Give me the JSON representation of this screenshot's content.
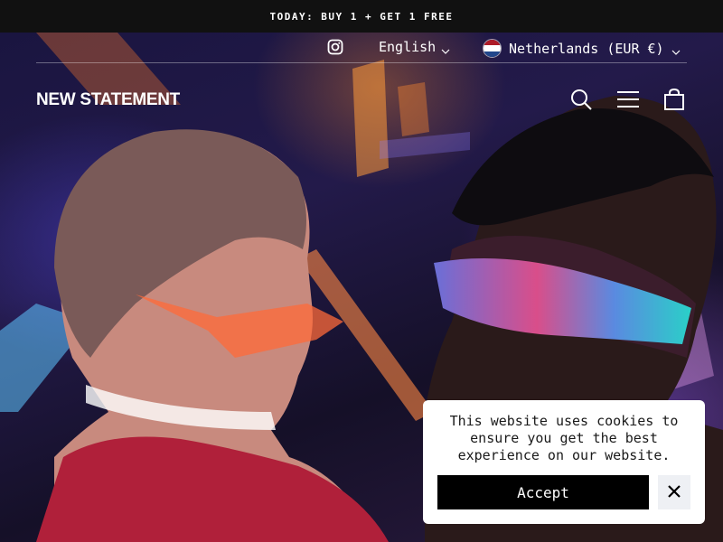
{
  "announcement": {
    "text": "TODAY: BUY 1 + GET 1 FREE"
  },
  "utility": {
    "instagram_icon": "instagram-icon",
    "language": "English",
    "country": "Netherlands (EUR €)",
    "flag_colors": [
      "#AE1C28",
      "#FFFFFF",
      "#21468B"
    ]
  },
  "header": {
    "logo": "NEW STATEMENT",
    "icons": [
      "search-icon",
      "menu-icon",
      "cart-icon"
    ]
  },
  "hero": {
    "image": "hero-image"
  },
  "cookie": {
    "message": "This website uses cookies to ensure you get the best experience on our website.",
    "accept_label": "Accept",
    "close_icon": "close-icon"
  },
  "colors": {
    "announcement_bg": "#111111",
    "accept_bg": "#000000",
    "close_bg": "#EEF0F4"
  }
}
